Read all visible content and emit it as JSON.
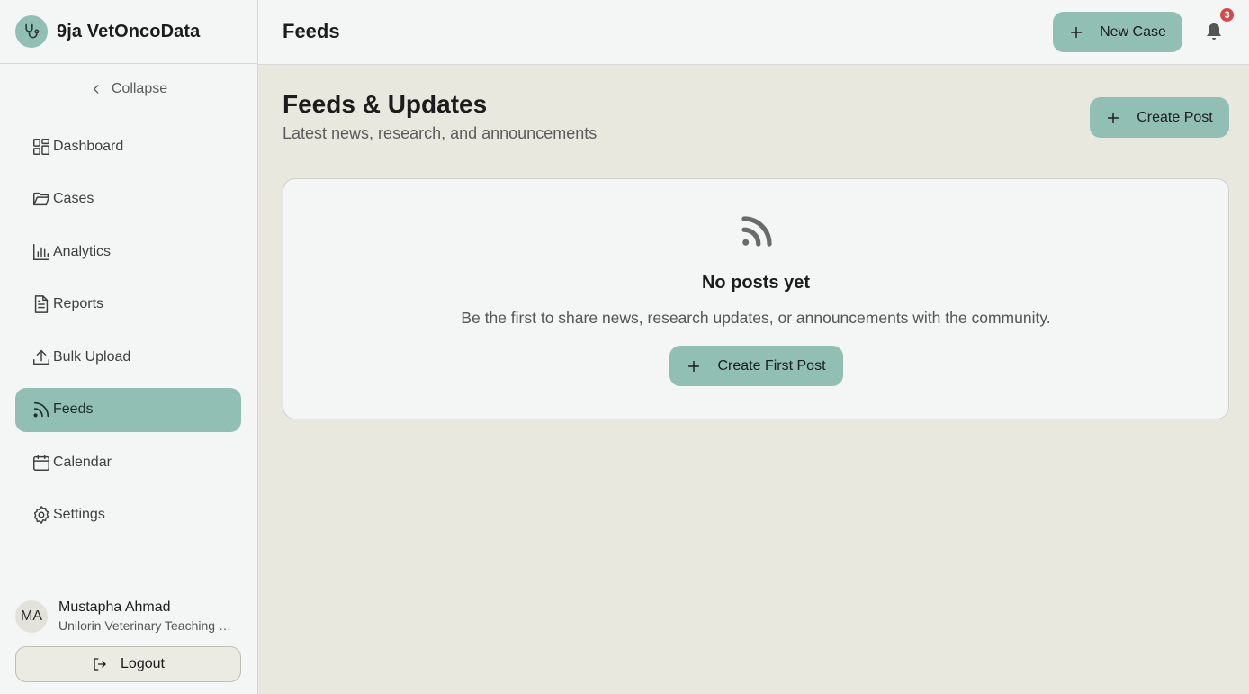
{
  "brand": {
    "name": "9ja VetOncoData"
  },
  "sidebar": {
    "collapse_label": "Collapse",
    "items": [
      {
        "label": "Dashboard",
        "icon": "dashboard-icon"
      },
      {
        "label": "Cases",
        "icon": "folder-icon"
      },
      {
        "label": "Analytics",
        "icon": "bar-chart-icon"
      },
      {
        "label": "Reports",
        "icon": "document-icon"
      },
      {
        "label": "Bulk Upload",
        "icon": "upload-icon"
      },
      {
        "label": "Feeds",
        "icon": "rss-icon",
        "active": true
      },
      {
        "label": "Calendar",
        "icon": "calendar-icon"
      },
      {
        "label": "Settings",
        "icon": "gear-icon"
      }
    ],
    "user": {
      "initials": "MA",
      "name": "Mustapha Ahmad",
      "org": "Unilorin Veterinary Teaching Hospital"
    },
    "logout_label": "Logout"
  },
  "header": {
    "title": "Feeds",
    "new_case_label": "New Case",
    "notification_count": "3"
  },
  "main": {
    "title": "Feeds & Updates",
    "subtitle": "Latest news, research, and announcements",
    "create_post_label": "Create Post",
    "empty": {
      "title": "No posts yet",
      "text": "Be the first to share news, research updates, or announcements with the community.",
      "button_label": "Create First Post"
    }
  },
  "colors": {
    "accent": "#91bfb3",
    "badge": "#d34949",
    "background": "#e8e8df",
    "panel": "#f4f6f5"
  }
}
